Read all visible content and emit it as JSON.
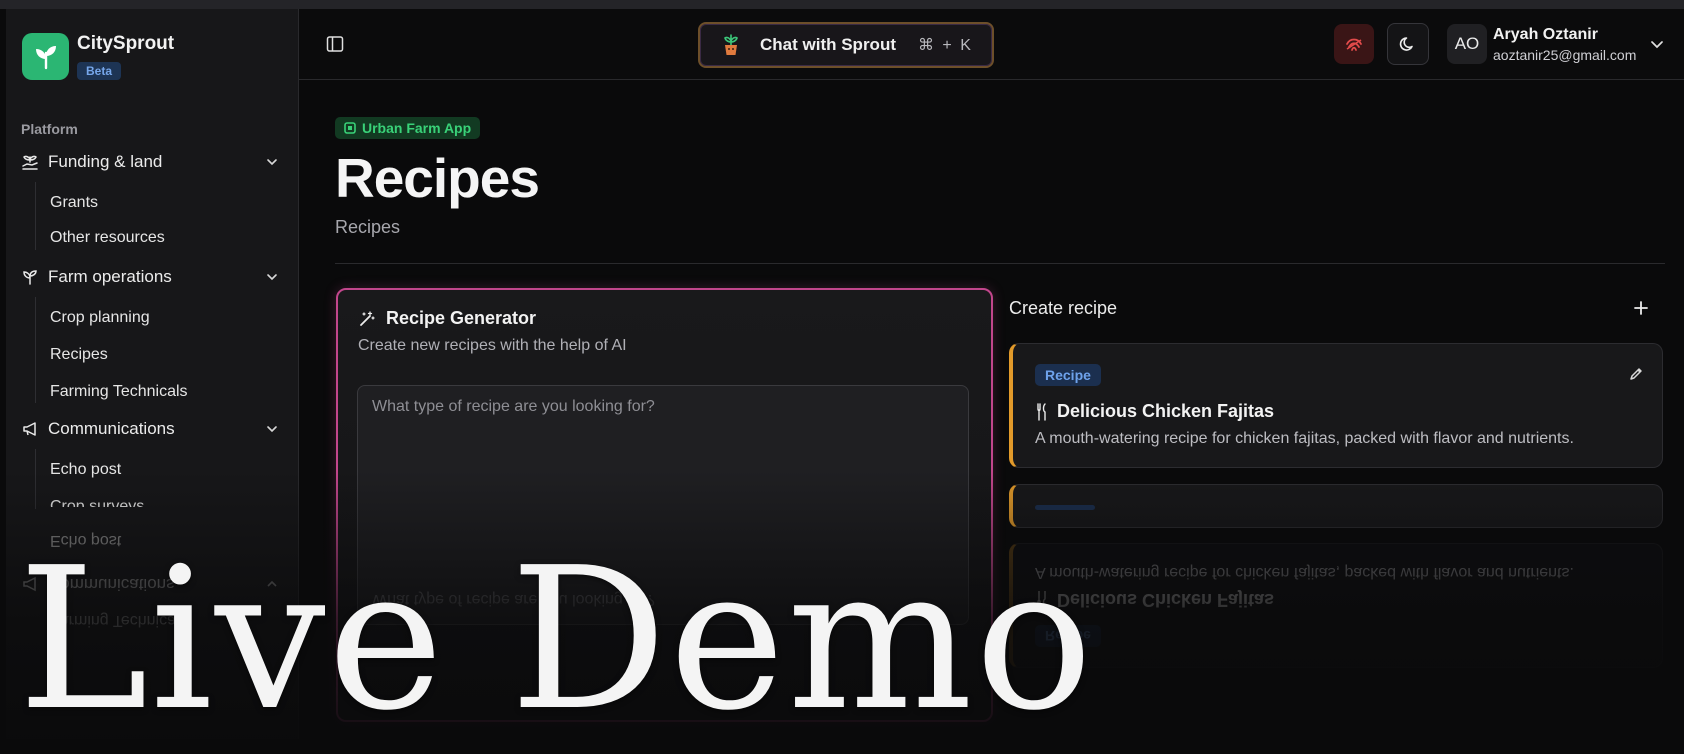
{
  "brand": {
    "name": "CitySprout",
    "badge": "Beta"
  },
  "sidebar": {
    "section": "Platform",
    "groups": [
      {
        "label": "Funding & land",
        "icon": "sprout-hand-icon",
        "items": [
          "Grants",
          "Other resources"
        ]
      },
      {
        "label": "Farm operations",
        "icon": "seedling-icon",
        "items": [
          "Crop planning",
          "Recipes",
          "Farming Technicals"
        ]
      },
      {
        "label": "Communications",
        "icon": "megaphone-icon",
        "items": [
          "Echo post",
          "Crop surveys"
        ]
      }
    ],
    "reflection": {
      "sub1": "Echo post",
      "group": "Communications",
      "sub2": "Farming Technicals"
    }
  },
  "header": {
    "chat_label": "Chat with Sprout",
    "shortcut": "⌘ + K",
    "user": {
      "initials": "AO",
      "name": "Aryah Oztanir",
      "email": "aoztanir25@gmail.com"
    }
  },
  "page": {
    "app_badge": "Urban Farm App",
    "title": "Recipes",
    "subtitle": "Recipes"
  },
  "generator": {
    "title": "Recipe Generator",
    "description": "Create new recipes with the help of AI",
    "placeholder": "What type of recipe are you looking for?"
  },
  "create": {
    "title": "Create recipe",
    "recipes": [
      {
        "badge": "Recipe",
        "title": "Delicious Chicken Fajitas",
        "description": "A mouth-watering recipe for chicken fajitas, packed with flavor and nutrients."
      }
    ]
  },
  "overlay": {
    "watermark": "Live Demo"
  },
  "colors": {
    "accent_green": "#2bb673",
    "card_border_pink": "#c2468c",
    "recipe_accent": "#e29a2a",
    "badge_blue": "#6ea2ec"
  }
}
